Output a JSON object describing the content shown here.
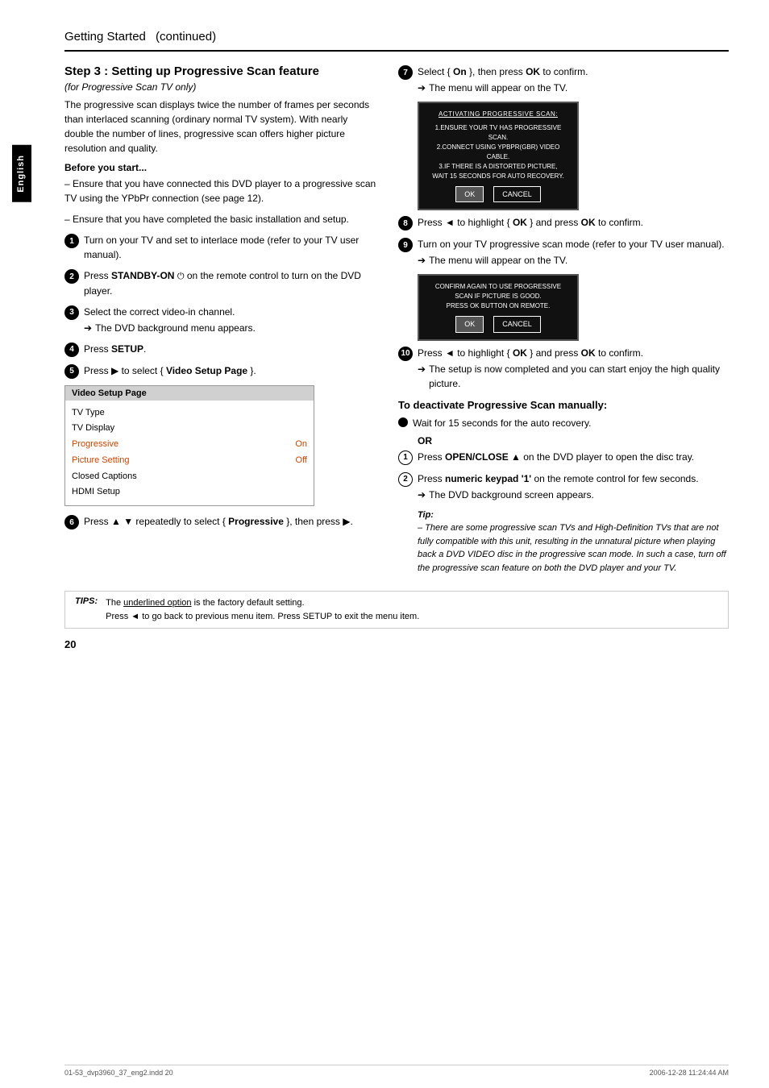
{
  "page": {
    "title": "Getting Started",
    "title_continued": "(continued)",
    "page_number": "20",
    "footer_file": "01-53_dvp3960_37_eng2.indd  20",
    "footer_date": "2006-12-28   11:24:44 AM"
  },
  "sidebar": {
    "label": "English"
  },
  "section": {
    "heading": "Step 3 : Setting up Progressive Scan feature",
    "subheading": "(for Progressive Scan TV only)",
    "intro": "The progressive scan displays twice the number of frames per seconds than interlaced scanning (ordinary normal TV system). With nearly double the number of lines, progressive scan offers higher picture resolution and quality.",
    "before_start_label": "Before you start...",
    "before_start_lines": [
      "– Ensure that you have connected this DVD player to a progressive scan TV using the YPbPr connection (see page 12).",
      "– Ensure that you have completed the basic installation and setup."
    ]
  },
  "left_steps": [
    {
      "num": "1",
      "text": "Turn on your TV and set to interlace mode (refer to your TV user manual)."
    },
    {
      "num": "2",
      "text": "Press STANDBY-ON",
      "text2": "on the remote control to turn on the DVD player."
    },
    {
      "num": "3",
      "text": "Select the correct video-in channel.",
      "subnote": "The DVD background menu appears."
    },
    {
      "num": "4",
      "text": "Press SETUP."
    },
    {
      "num": "5",
      "text": "Press ▶ to select { Video Setup Page }."
    }
  ],
  "setup_box": {
    "title": "Video Setup Page",
    "rows": [
      {
        "label": "TV Type",
        "value": "",
        "highlighted": false
      },
      {
        "label": "TV Display",
        "value": "",
        "highlighted": false
      },
      {
        "label": "Progressive",
        "value": "On",
        "highlighted": true
      },
      {
        "label": "Picture Setting",
        "value": "Off",
        "highlighted": true
      },
      {
        "label": "Closed Captions",
        "value": "",
        "highlighted": false
      },
      {
        "label": "HDMI Setup",
        "value": "",
        "highlighted": false
      }
    ]
  },
  "step6": {
    "num": "6",
    "text": "Press ▲ ▼ repeatedly to select { Progressive }, then press ▶."
  },
  "right_steps": [
    {
      "num": "7",
      "text": "Select { On }, then press OK to confirm.",
      "subnote": "The menu will appear on the TV."
    },
    {
      "screen1": {
        "title": "Activating Progressive Scan:",
        "lines": [
          "1.ENSURE YOUR TV HAS PROGRESSIVE SCAN.",
          "2.CONNECT USING YPBPR(GBR) VIDEO CABLE.",
          "3.IF THERE IS A DISTORTED PICTURE,",
          "WAIT 15 SECONDS FOR AUTO RECOVERY."
        ],
        "btn_ok": "OK",
        "btn_cancel": "CANCEL"
      }
    },
    {
      "num": "8",
      "text": "Press ◄ to highlight { OK } and press OK to confirm."
    },
    {
      "num": "9",
      "text": "Turn on your TV progressive scan mode (refer to your TV user manual).",
      "subnote": "The menu will appear on the TV."
    },
    {
      "screen2": {
        "title": "",
        "lines": [
          "CONFIRM AGAIN TO USE PROGRESSIVE",
          "SCAN IF PICTURE IS GOOD.",
          "PRESS OK BUTTON ON REMOTE."
        ],
        "btn_ok": "OK",
        "btn_cancel": "CANCEL"
      }
    },
    {
      "num": "10",
      "text": "Press ◄ to highlight { OK } and press OK to confirm.",
      "subnote": "The setup is now completed and you can start enjoy the high quality picture."
    }
  ],
  "deactivate": {
    "heading": "To deactivate Progressive Scan manually:",
    "bullet1": {
      "text": "Wait for 15 seconds for the auto recovery.",
      "or": "OR"
    },
    "step1": {
      "num": "1",
      "text": "Press OPEN/CLOSE ▲ on the DVD player to open the disc tray."
    },
    "step2": {
      "num": "2",
      "text": "Press numeric keypad '1' on the remote control for few seconds.",
      "subnote": "The DVD background screen appears."
    },
    "tip_label": "Tip:",
    "tip_text": "– There are some progressive scan TVs and High-Definition TVs that are not fully compatible with this unit, resulting in the unnatural picture when playing back a DVD VIDEO disc in the progressive scan mode. In such a case, turn off the progressive scan feature on both the DVD player and your TV."
  },
  "tips_bar": {
    "label": "TIPS:",
    "line1": "The underlined option is the factory default setting.",
    "line2": "Press ◄ to go back to previous menu item. Press SETUP to exit the menu item."
  }
}
